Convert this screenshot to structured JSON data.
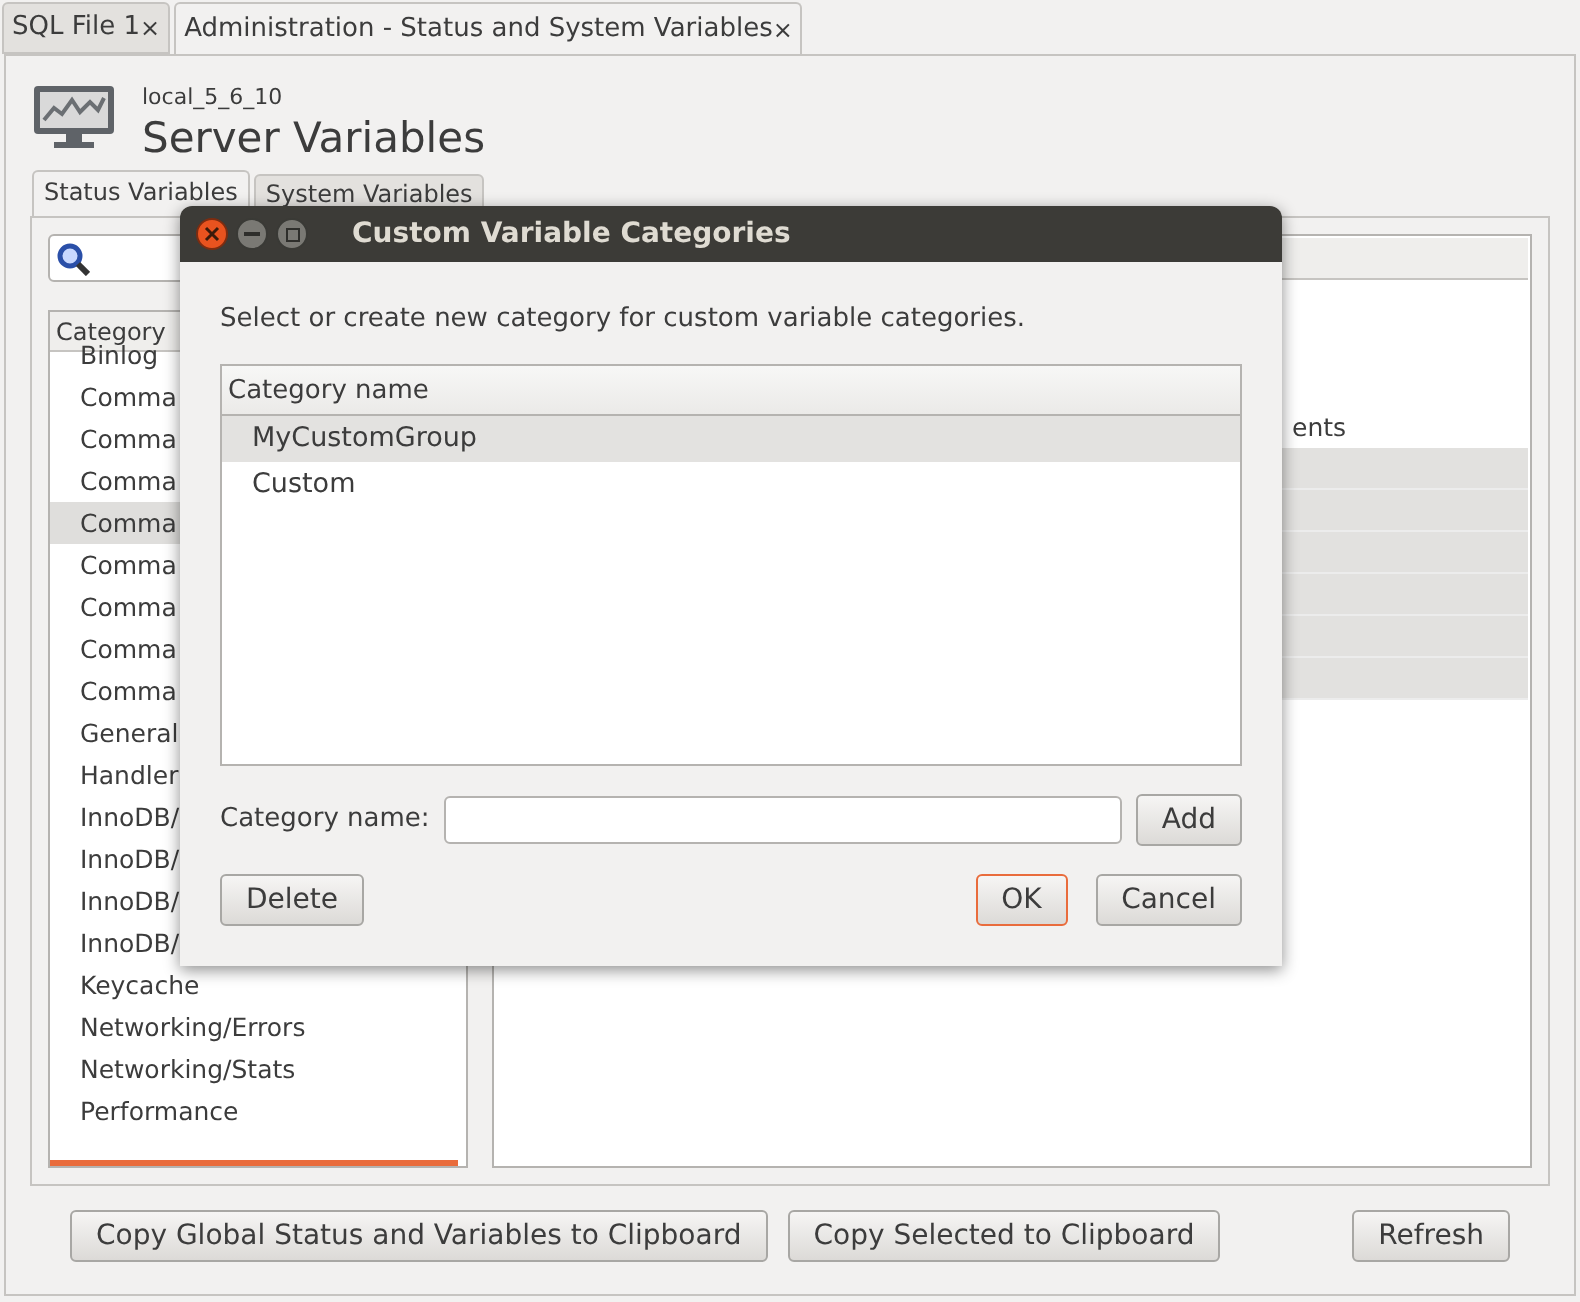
{
  "doc_tabs": [
    {
      "label": "SQL File 1",
      "close": "×",
      "selected": false
    },
    {
      "label": "Administration - Status and System Variables",
      "close": "×",
      "selected": true
    }
  ],
  "header": {
    "server": "local_5_6_10",
    "title": "Server Variables"
  },
  "panel_tabs": [
    {
      "label": "Status Variables",
      "selected": true
    },
    {
      "label": "System Variables",
      "selected": false
    }
  ],
  "category_list": {
    "column": "Category",
    "items": [
      {
        "label": "Binlog",
        "selected": false
      },
      {
        "label": "Comma",
        "selected": false
      },
      {
        "label": "Comma",
        "selected": false
      },
      {
        "label": "Comma",
        "selected": false
      },
      {
        "label": "Comma",
        "selected": true
      },
      {
        "label": "Comma",
        "selected": false
      },
      {
        "label": "Comma",
        "selected": false
      },
      {
        "label": "Comma",
        "selected": false
      },
      {
        "label": "Comma",
        "selected": false
      },
      {
        "label": "General",
        "selected": false
      },
      {
        "label": "Handler",
        "selected": false
      },
      {
        "label": "InnoDB/",
        "selected": false
      },
      {
        "label": "InnoDB/",
        "selected": false
      },
      {
        "label": "InnoDB/",
        "selected": false
      },
      {
        "label": "InnoDB/",
        "selected": false
      },
      {
        "label": "Keycache",
        "selected": false
      },
      {
        "label": "Networking/Errors",
        "selected": false
      },
      {
        "label": "Networking/Stats",
        "selected": false
      },
      {
        "label": "Performance",
        "selected": false
      }
    ]
  },
  "variables_table": {
    "rows": [
      {
        "text": "",
        "selected": false
      },
      {
        "text": "",
        "selected": false
      },
      {
        "text": "",
        "selected": false
      },
      {
        "text": "ents",
        "selected": false
      },
      {
        "text": "",
        "selected": true
      },
      {
        "text": "",
        "selected": true
      },
      {
        "text": "",
        "selected": true
      },
      {
        "text": "",
        "selected": true
      },
      {
        "text": "",
        "selected": true
      },
      {
        "text": "",
        "selected": true
      }
    ]
  },
  "buttons": [
    "Copy Global Status and Variables to Clipboard",
    "Copy Selected to Clipboard",
    "Refresh"
  ],
  "dialog": {
    "title": "Custom Variable Categories",
    "prompt": "Select or create new category for custom variable categories.",
    "column": "Category name",
    "items": [
      {
        "label": "MyCustomGroup",
        "selected": true
      },
      {
        "label": "Custom",
        "selected": false
      }
    ],
    "field_label": "Category name:",
    "add": "Add",
    "delete": "Delete",
    "ok": "OK",
    "cancel": "Cancel"
  }
}
